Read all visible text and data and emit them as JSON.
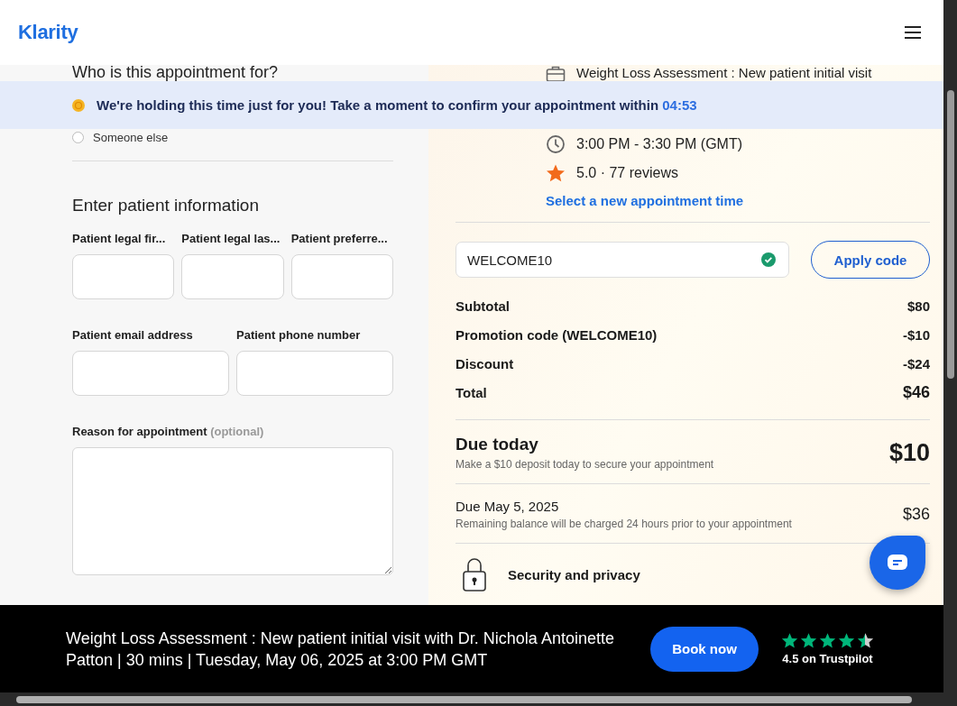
{
  "header": {
    "logo": "Klarity"
  },
  "banner": {
    "text": "We're holding this time just for you! Take a moment to confirm your appointment within",
    "timer": "04:53"
  },
  "patient_form": {
    "question": "Who is this appointment for?",
    "options": [
      {
        "label": "Someone else",
        "selected": false
      }
    ],
    "section_title": "Enter patient information",
    "field_rows": [
      [
        {
          "label": "Patient legal fir..."
        },
        {
          "label": "Patient legal las..."
        },
        {
          "label": "Patient preferre..."
        }
      ],
      [
        {
          "label": "Patient email address"
        },
        {
          "label": "Patient phone number"
        }
      ]
    ],
    "reason": {
      "label": "Reason for appointment",
      "note": "(optional)"
    }
  },
  "appointment": {
    "service": "Weight Loss Assessment : New patient initial visit",
    "time": "3:00 PM - 3:30 PM (GMT)",
    "rating": "5.0 · 77 reviews",
    "change_link": "Select a new appointment time"
  },
  "promo": {
    "value": "WELCOME10",
    "valid": true,
    "button": "Apply code"
  },
  "summary": [
    {
      "label": "Subtotal",
      "amount": "$80",
      "kind": "line"
    },
    {
      "label": "Promotion code (WELCOME10)",
      "amount": "-$10",
      "kind": "line"
    },
    {
      "label": "Discount",
      "amount": "-$24",
      "kind": "line"
    },
    {
      "label": "Total",
      "amount": "$46",
      "kind": "total"
    }
  ],
  "due_today": {
    "title": "Due today",
    "note": "Make a $10 deposit today to secure your appointment",
    "amount": "$10"
  },
  "due_later": {
    "title": "Due May 5, 2025",
    "note": "Remaining balance will be charged 24 hours prior to your appointment",
    "amount": "$36"
  },
  "security": {
    "title": "Security and privacy"
  },
  "footer": {
    "summary": "Weight Loss Assessment : New patient initial visit with Dr. Nichola Antoinette Patton | 30 mins | Tuesday, May 06, 2025 at 3:00 PM GMT",
    "button": "Book now",
    "trustpilot": {
      "stars": 4.5,
      "label": "4.5 on Trustpilot"
    }
  }
}
